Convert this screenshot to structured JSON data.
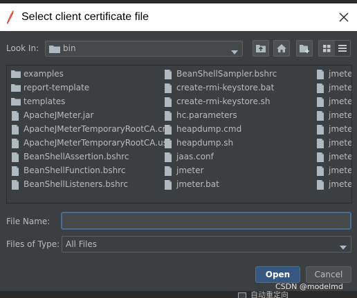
{
  "window": {
    "title": "Select client certificate file",
    "close_icon": "close-icon"
  },
  "toolbar": {
    "look_in_label": "Look In:",
    "look_in_value": "bin",
    "up_icon": "up-folder-icon",
    "home_icon": "home-icon",
    "new_folder_icon": "new-folder-icon",
    "list_view_icon": "list-view-icon",
    "details_view_icon": "details-view-icon"
  },
  "files": {
    "column1": [
      {
        "name": "examples",
        "kind": "folder"
      },
      {
        "name": "report-template",
        "kind": "folder"
      },
      {
        "name": "templates",
        "kind": "folder"
      },
      {
        "name": "ApacheJMeter.jar",
        "kind": "file"
      },
      {
        "name": "ApacheJMeterTemporaryRootCA.crt",
        "kind": "file"
      },
      {
        "name": "ApacheJMeterTemporaryRootCA.usr",
        "kind": "file"
      },
      {
        "name": "BeanShellAssertion.bshrc",
        "kind": "file"
      },
      {
        "name": "BeanShellFunction.bshrc",
        "kind": "file"
      },
      {
        "name": "BeanShellListeners.bshrc",
        "kind": "file"
      }
    ],
    "column2": [
      {
        "name": "BeanShellSampler.bshrc",
        "kind": "file"
      },
      {
        "name": "create-rmi-keystore.bat",
        "kind": "file"
      },
      {
        "name": "create-rmi-keystore.sh",
        "kind": "file"
      },
      {
        "name": "hc.parameters",
        "kind": "file"
      },
      {
        "name": "heapdump.cmd",
        "kind": "file"
      },
      {
        "name": "heapdump.sh",
        "kind": "file"
      },
      {
        "name": "jaas.conf",
        "kind": "file"
      },
      {
        "name": "jmeter",
        "kind": "file"
      },
      {
        "name": "jmeter.bat",
        "kind": "file"
      }
    ],
    "column3": [
      {
        "name": "jmeter",
        "kind": "file"
      },
      {
        "name": "jmeter",
        "kind": "file"
      },
      {
        "name": "jmeter",
        "kind": "file"
      },
      {
        "name": "jmeter",
        "kind": "file"
      },
      {
        "name": "jmeter",
        "kind": "file"
      },
      {
        "name": "jmeter",
        "kind": "file"
      },
      {
        "name": "jmeter",
        "kind": "file"
      },
      {
        "name": "jmeter",
        "kind": "file"
      },
      {
        "name": "jmeter",
        "kind": "file"
      }
    ]
  },
  "form": {
    "file_name_label": "File Name:",
    "file_name_value": "",
    "file_type_label": "Files of Type:",
    "file_type_value": "All Files"
  },
  "buttons": {
    "open": "Open",
    "cancel": "Cancel"
  },
  "watermark": "CSDN @modelmd",
  "background_checkbox_text": "自动重定向",
  "colors": {
    "background": "#3c3f41",
    "accent": "#365880",
    "focus_border": "#466d94",
    "title_bar": "#ffffff"
  }
}
